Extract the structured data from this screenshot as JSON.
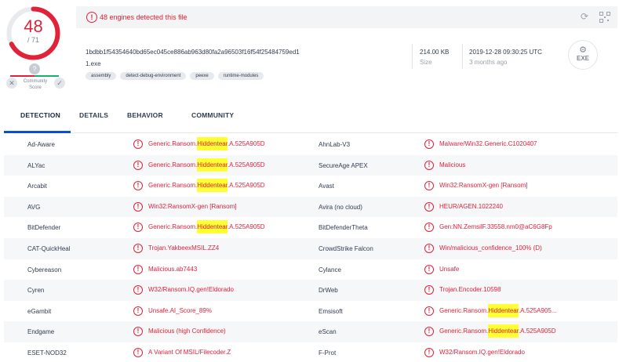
{
  "score": {
    "detected": "48",
    "total": "/ 71",
    "color": "#e0223b",
    "community_bubble": "?",
    "community_label": "Community Score"
  },
  "banner": {
    "message": "48 engines detected this file",
    "icons": [
      "alert-icon",
      "refresh-icon",
      "qr-code-icon"
    ]
  },
  "file": {
    "hash": "1bdbb1f54354640bd65ec045ce886ab963d80fa2a96503f16f54f25484759ed1",
    "name": "1.exe",
    "tags": [
      "assembly",
      "detect-debug-environment",
      "peexe",
      "runtime-modules"
    ],
    "size_value": "214.00 KB",
    "size_label": "Size",
    "date_value": "2019-12-28 09:30:25 UTC",
    "date_label": "3 months ago",
    "type_label": "EXE"
  },
  "tabs": [
    {
      "label": "DETECTION",
      "active": true
    },
    {
      "label": "DETAILS",
      "active": false
    },
    {
      "label": "BEHAVIOR",
      "active": false
    },
    {
      "label": "COMMUNITY",
      "active": false
    }
  ],
  "detections": [
    {
      "left": {
        "engine": "Ad-Aware",
        "pre": "Generic.Ransom.",
        "hl": "Hiddentear",
        "post": ".A.525A905D"
      },
      "right": {
        "engine": "AhnLab-V3",
        "pre": "Malware/Win32.Generic.C1020407",
        "hl": "",
        "post": ""
      }
    },
    {
      "left": {
        "engine": "ALYac",
        "pre": "Generic.Ransom.",
        "hl": "Hiddentear",
        "post": ".A.525A905D"
      },
      "right": {
        "engine": "SecureAge APEX",
        "pre": "Malicious",
        "hl": "",
        "post": ""
      }
    },
    {
      "left": {
        "engine": "Arcabit",
        "pre": "Generic.Ransom.",
        "hl": "Hiddentear",
        "post": ".A.525A905D"
      },
      "right": {
        "engine": "Avast",
        "pre": "Win32:RansomX-gen [Ransom]",
        "hl": "",
        "post": ""
      }
    },
    {
      "left": {
        "engine": "AVG",
        "pre": "Win32:RansomX-gen [Ransom]",
        "hl": "",
        "post": ""
      },
      "right": {
        "engine": "Avira (no cloud)",
        "pre": "HEUR/AGEN.1022240",
        "hl": "",
        "post": ""
      }
    },
    {
      "left": {
        "engine": "BitDefender",
        "pre": "Generic.Ransom.",
        "hl": "Hiddentear",
        "post": ".A.525A905D"
      },
      "right": {
        "engine": "BitDefenderTheta",
        "pre": "Gen:NN.ZemsilF.33558.nm0@aC6G8Fp",
        "hl": "",
        "post": ""
      }
    },
    {
      "left": {
        "engine": "CAT-QuickHeal",
        "pre": "Trojan.YakbeexMSIL.ZZ4",
        "hl": "",
        "post": ""
      },
      "right": {
        "engine": "CrowdStrike Falcon",
        "pre": "Win/malicious_confidence_100% (D)",
        "hl": "",
        "post": ""
      }
    },
    {
      "left": {
        "engine": "Cybereason",
        "pre": "Malicious.ab7443",
        "hl": "",
        "post": ""
      },
      "right": {
        "engine": "Cylance",
        "pre": "Unsafe",
        "hl": "",
        "post": ""
      }
    },
    {
      "left": {
        "engine": "Cyren",
        "pre": "W32/Ransom.IQ.gen!Eldorado",
        "hl": "",
        "post": ""
      },
      "right": {
        "engine": "DrWeb",
        "pre": "Trojan.Encoder.10598",
        "hl": "",
        "post": ""
      }
    },
    {
      "left": {
        "engine": "eGambit",
        "pre": "Unsafe.AI_Score_89%",
        "hl": "",
        "post": ""
      },
      "right": {
        "engine": "Emsisoft",
        "pre": "Generic.Ransom.",
        "hl": "Hiddentear",
        "post": ".A.525A905..."
      }
    },
    {
      "left": {
        "engine": "Endgame",
        "pre": "Malicious (high Confidence)",
        "hl": "",
        "post": ""
      },
      "right": {
        "engine": "eScan",
        "pre": "Generic.Ransom.",
        "hl": "Hiddentear",
        "post": ".A.525A905D"
      }
    },
    {
      "left": {
        "engine": "ESET-NOD32",
        "pre": "A Variant Of MSIL/Filecoder.Z",
        "hl": "",
        "post": ""
      },
      "right": {
        "engine": "F-Prot",
        "pre": "W32/Ransom.IQ.gen!Eldorado",
        "hl": "",
        "post": ""
      }
    }
  ]
}
